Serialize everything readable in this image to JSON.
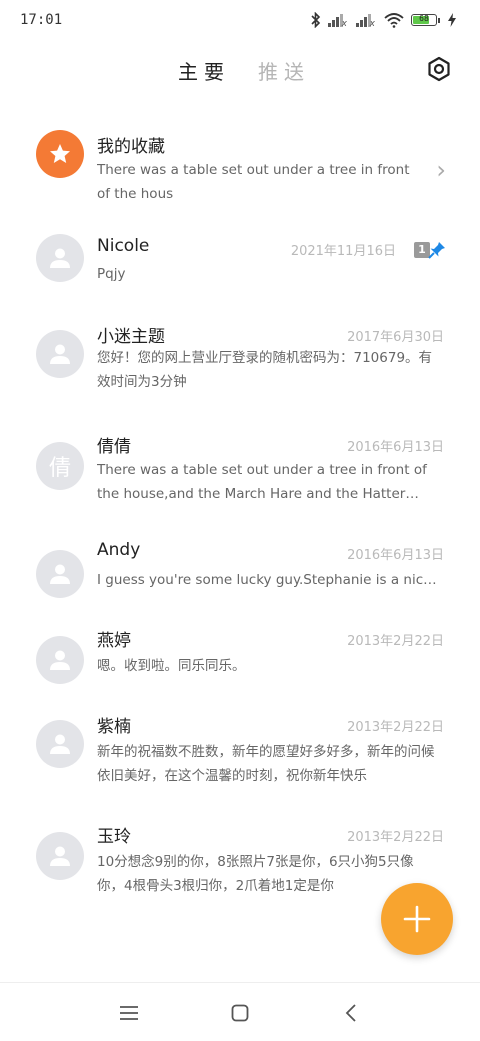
{
  "status": {
    "time": "17:01",
    "battery": "68",
    "battery_level": 0.68
  },
  "header": {
    "tab_main": "主要",
    "tab_push": "推送"
  },
  "items": [
    {
      "name": "我的收藏",
      "preview": "There was a table set out under a tree in front of the hous",
      "date": "",
      "avatar_icon": "star-icon"
    },
    {
      "name": "Nicole",
      "preview": "Pqjy",
      "date": "2021年11月16日",
      "badge": "1",
      "pinned": true
    },
    {
      "name": "小迷主题",
      "preview": "您好！您的网上营业厅登录的随机密码为：710679。有效时间为3分钟",
      "date": "2017年6月30日"
    },
    {
      "name": "倩倩",
      "preview": "There was a table set out under a tree in front of the house,and the March Hare and the Hatter were having tea",
      "date": "2016年6月13日",
      "avatar_letter": "倩"
    },
    {
      "name": "Andy",
      "preview": "I guess you're some lucky guy.Stephanie is a nice girl.",
      "date": "2016年6月13日"
    },
    {
      "name": "燕婷",
      "preview": "嗯。收到啦。同乐同乐。",
      "date": "2013年2月22日"
    },
    {
      "name": "紫楠",
      "preview": "新年的祝福数不胜数，新年的愿望好多好多，新年的问候依旧美好，在这个温馨的时刻，祝你新年快乐",
      "date": "2013年2月22日"
    },
    {
      "name": "玉玲",
      "preview": "10分想念9别的你，8张照片7张是你，6只小狗5只像你，4根骨头3根归你，2爪着地1定是你",
      "date": "2013年2月22日"
    }
  ],
  "colors": {
    "accent": "#f8a42f",
    "favorite": "#f47a35",
    "pin": "#1e88e5"
  }
}
